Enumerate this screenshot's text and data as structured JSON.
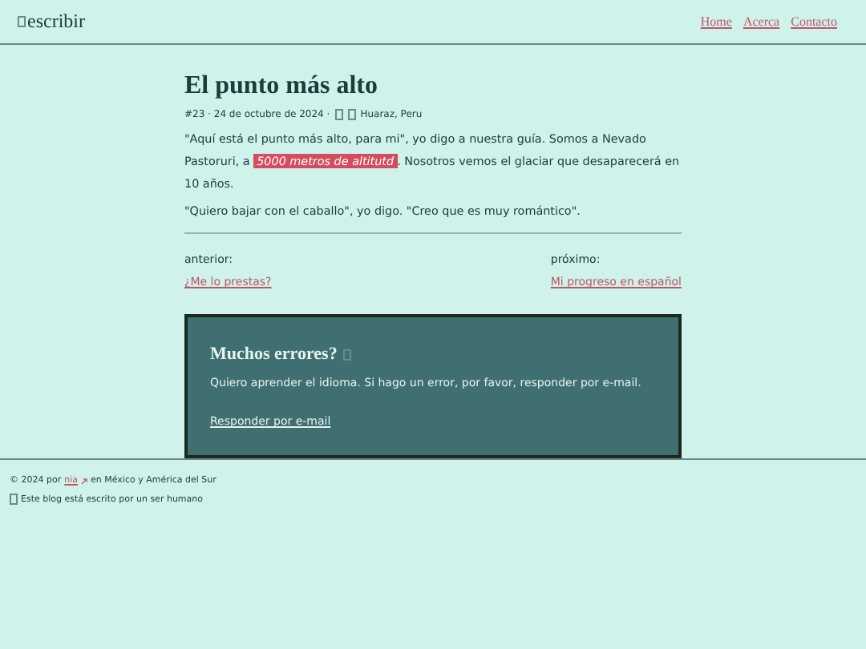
{
  "site": {
    "name": "escribir"
  },
  "nav": [
    {
      "label": "Home"
    },
    {
      "label": "Acerca"
    },
    {
      "label": "Contacto"
    }
  ],
  "post": {
    "title": "El punto más alto",
    "meta_before": "#23 · 24 de octubre de 2024 ·",
    "meta_place": "Huaraz, Peru",
    "paragraphs": [
      {
        "before": "\"Aquí está el punto más alto, para mi\", yo digo a nuestra guía. Somos a Nevado Pastoruri, a ",
        "highlight": "5000 metros de altitutd",
        "after": ". Nosotros vemos el glaciar que desaparecerá en 10 años."
      },
      {
        "before": "\"Quiero bajar con el caballo\", yo digo. \"Creo que es muy romántico\"."
      }
    ]
  },
  "pager": {
    "prev_label": "anterior:",
    "prev_link": "¿Me lo prestas?",
    "next_label": "próximo:",
    "next_link": "Mi progreso en español"
  },
  "callout": {
    "title": "Muchos errores?",
    "text": "Quiero aprender el idioma. Si hago un error, por favor, responder por e-mail.",
    "link": "Responder por e-mail"
  },
  "footer": {
    "copyright_before": "© 2024 por",
    "author": "nia",
    "copyright_after": "en México y América del Sur",
    "note": "Este blog está escrito por un ser humano"
  }
}
